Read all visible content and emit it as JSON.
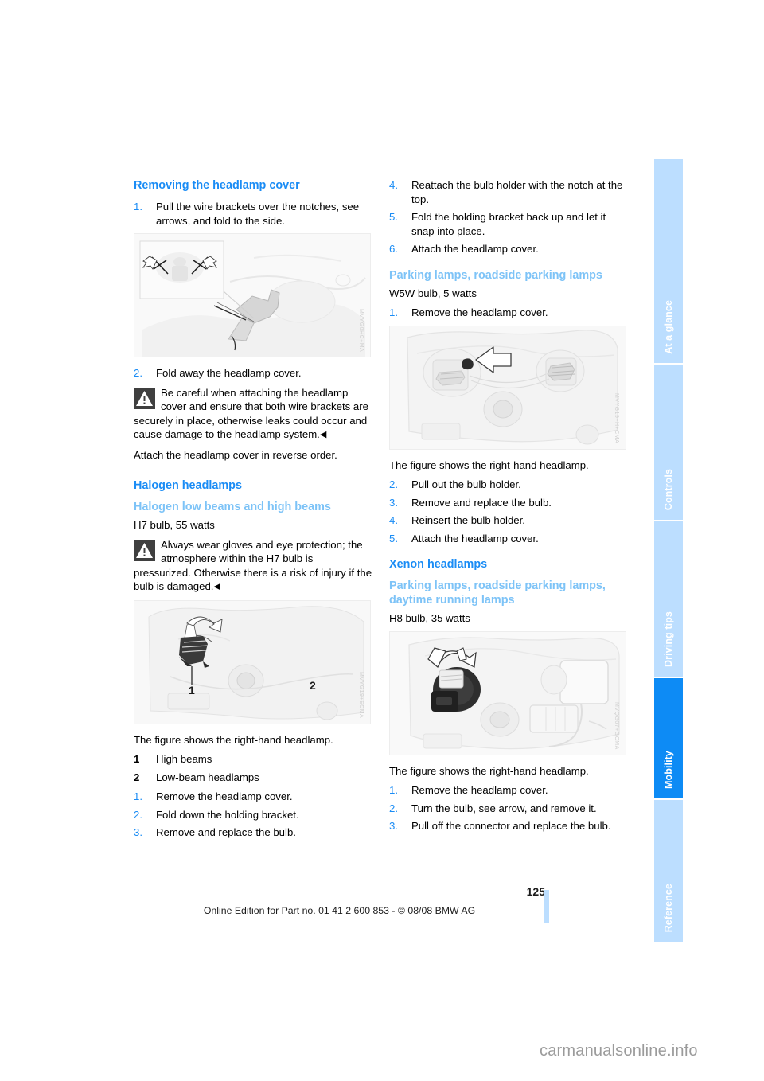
{
  "page": {
    "number": "125",
    "edition_line": "Online Edition for Part no. 01 41 2 600 853 - © 08/08 BMW AG",
    "watermark": "carmanualsonline.info"
  },
  "tabs": [
    {
      "label": "At a glance",
      "active": false
    },
    {
      "label": "Controls",
      "active": false
    },
    {
      "label": "Driving tips",
      "active": false
    },
    {
      "label": "Mobility",
      "active": true
    },
    {
      "label": "Reference",
      "active": false
    }
  ],
  "colors": {
    "heading_primary": "#1a8cf5",
    "heading_secondary": "#7dc3f7",
    "tab_inactive": "#bcdeff",
    "tab_active": "#0d8bf5",
    "body_text": "#000000"
  },
  "left_column": {
    "heading_removing_cover": "Removing the headlamp cover",
    "step1": {
      "num": "1.",
      "text": "Pull the wire brackets over the notches, see arrows, and fold to the side."
    },
    "figure1": {
      "code": "MVYG0HC+MA"
    },
    "step2": {
      "num": "2.",
      "text": "Fold away the headlamp cover."
    },
    "warning1": "Be careful when attaching the headlamp cover and ensure that both wire brackets are securely in place, otherwise leaks could occur and cause damage to the headlamp system.",
    "attach_note": "Attach the headlamp cover in reverse order.",
    "heading_halogen": "Halogen headlamps",
    "subheading_halogen_beams": "Halogen low beams and high beams",
    "bulb_spec": "H7 bulb, 55 watts",
    "warning2": "Always wear gloves and eye protection; the atmosphere within the H7 bulb is pressurized. Otherwise there is a risk of injury if the bulb is damaged.",
    "figure2": {
      "code": "MVYG19+ECMA",
      "callout1": "1",
      "callout2": "2"
    },
    "figure_caption": "The figure shows the right-hand headlamp.",
    "legend": [
      {
        "num": "1",
        "text": "High beams"
      },
      {
        "num": "2",
        "text": "Low-beam headlamps"
      }
    ],
    "steps": [
      {
        "num": "1.",
        "text": "Remove the headlamp cover."
      },
      {
        "num": "2.",
        "text": "Fold down the holding bracket."
      },
      {
        "num": "3.",
        "text": "Remove and replace the bulb."
      }
    ]
  },
  "right_column": {
    "steps_top": [
      {
        "num": "4.",
        "text": "Reattach the bulb holder with the notch at the top."
      },
      {
        "num": "5.",
        "text": "Fold the holding bracket back up and let it snap into place."
      },
      {
        "num": "6.",
        "text": "Attach the headlamp cover."
      }
    ],
    "subheading_parking": "Parking lamps, roadside parking lamps",
    "bulb_spec_w5w": "W5W bulb, 5 watts",
    "step1": {
      "num": "1.",
      "text": "Remove the headlamp cover."
    },
    "figure3": {
      "code": "MVYG19+H+CMA"
    },
    "figure3_caption": "The figure shows the right-hand headlamp.",
    "steps_mid": [
      {
        "num": "2.",
        "text": "Pull out the bulb holder."
      },
      {
        "num": "3.",
        "text": "Remove and replace the bulb."
      },
      {
        "num": "4.",
        "text": "Reinsert the bulb holder."
      },
      {
        "num": "5.",
        "text": "Attach the headlamp cover."
      }
    ],
    "heading_xenon": "Xenon headlamps",
    "subheading_xenon_parking": "Parking lamps, roadside parking lamps, daytime running lamps",
    "bulb_spec_h8": "H8 bulb, 35 watts",
    "figure4": {
      "code": "MVQG07+GCMA"
    },
    "figure4_caption": "The figure shows the right-hand headlamp.",
    "steps_bottom": [
      {
        "num": "1.",
        "text": "Remove the headlamp cover."
      },
      {
        "num": "2.",
        "text": "Turn the bulb, see arrow, and remove it."
      },
      {
        "num": "3.",
        "text": "Pull off the connector and replace the bulb."
      }
    ]
  }
}
